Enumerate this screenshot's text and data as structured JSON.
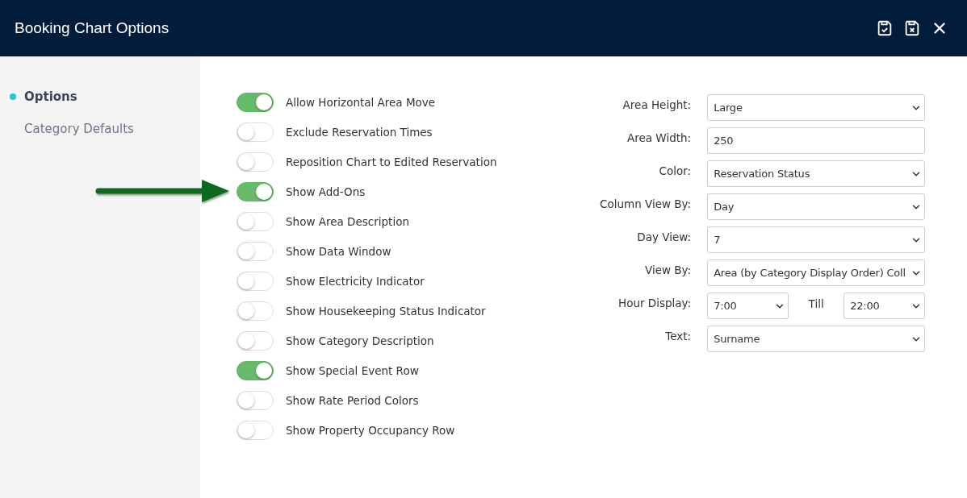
{
  "window": {
    "title": "Booking Chart Options"
  },
  "sidebar": {
    "items": [
      {
        "label": "Options",
        "selected": true
      },
      {
        "label": "Category Defaults",
        "selected": false
      }
    ]
  },
  "toggles": [
    {
      "label": "Allow Horizontal Area Move",
      "on": true,
      "highlighted": false
    },
    {
      "label": "Exclude Reservation Times",
      "on": false,
      "highlighted": false
    },
    {
      "label": "Reposition Chart to Edited Reservation",
      "on": false,
      "highlighted": false
    },
    {
      "label": "Show Add-Ons",
      "on": true,
      "highlighted": true
    },
    {
      "label": "Show Area Description",
      "on": false,
      "highlighted": false
    },
    {
      "label": "Show Data Window",
      "on": false,
      "highlighted": false
    },
    {
      "label": "Show Electricity Indicator",
      "on": false,
      "highlighted": false
    },
    {
      "label": "Show Housekeeping Status Indicator",
      "on": false,
      "highlighted": false
    },
    {
      "label": "Show Category Description",
      "on": false,
      "highlighted": false
    },
    {
      "label": "Show Special Event Row",
      "on": true,
      "highlighted": false
    },
    {
      "label": "Show Rate Period Colors",
      "on": false,
      "highlighted": false
    },
    {
      "label": "Show Property Occupancy Row",
      "on": false,
      "highlighted": false
    }
  ],
  "fields": [
    {
      "label": "Area Height:",
      "kind": "select",
      "value": "Large"
    },
    {
      "label": "Area Width:",
      "kind": "input",
      "value": "250"
    },
    {
      "label": "Color:",
      "kind": "select",
      "value": "Reservation Status"
    },
    {
      "label": "Column View By:",
      "kind": "select",
      "value": "Day"
    },
    {
      "label": "Day View:",
      "kind": "select",
      "value": "7"
    },
    {
      "label": "View By:",
      "kind": "select",
      "value": "Area (by Category Display Order) Coll"
    },
    {
      "label": "Hour Display:",
      "kind": "range",
      "value": "7:00",
      "separator": "Till",
      "to": "22:00"
    },
    {
      "label": "Text:",
      "kind": "select",
      "value": "Surname"
    }
  ]
}
